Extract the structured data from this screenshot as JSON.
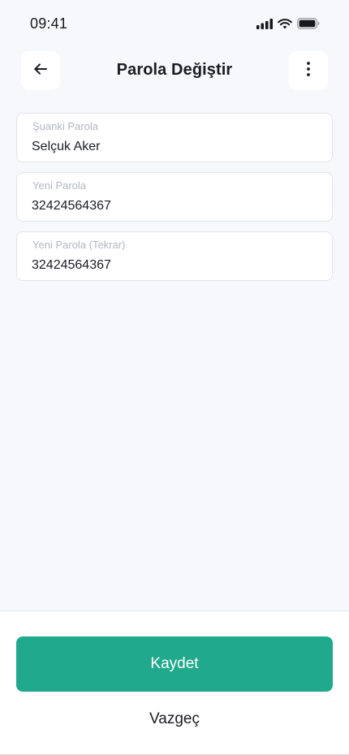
{
  "status_bar": {
    "time": "09:41",
    "icons": [
      "signal-icon",
      "wifi-icon",
      "battery-icon"
    ]
  },
  "header": {
    "title": "Parola Değiştir",
    "back_icon": "arrow-left-icon",
    "more_icon": "more-vertical-icon"
  },
  "form": {
    "fields": [
      {
        "label": "Şuanki Parola",
        "value": "Selçuk Aker"
      },
      {
        "label": "Yeni Parola",
        "value": "32424564367"
      },
      {
        "label": "Yeni Parola (Tekrar)",
        "value": "32424564367"
      }
    ]
  },
  "actions": {
    "save_label": "Kaydet",
    "cancel_label": "Vazgeç"
  },
  "colors": {
    "accent": "#20a98c",
    "background": "#f7f8fb",
    "surface": "#ffffff",
    "border": "#e1e4ea",
    "label": "#b2b6be",
    "text": "#1b1d22"
  }
}
